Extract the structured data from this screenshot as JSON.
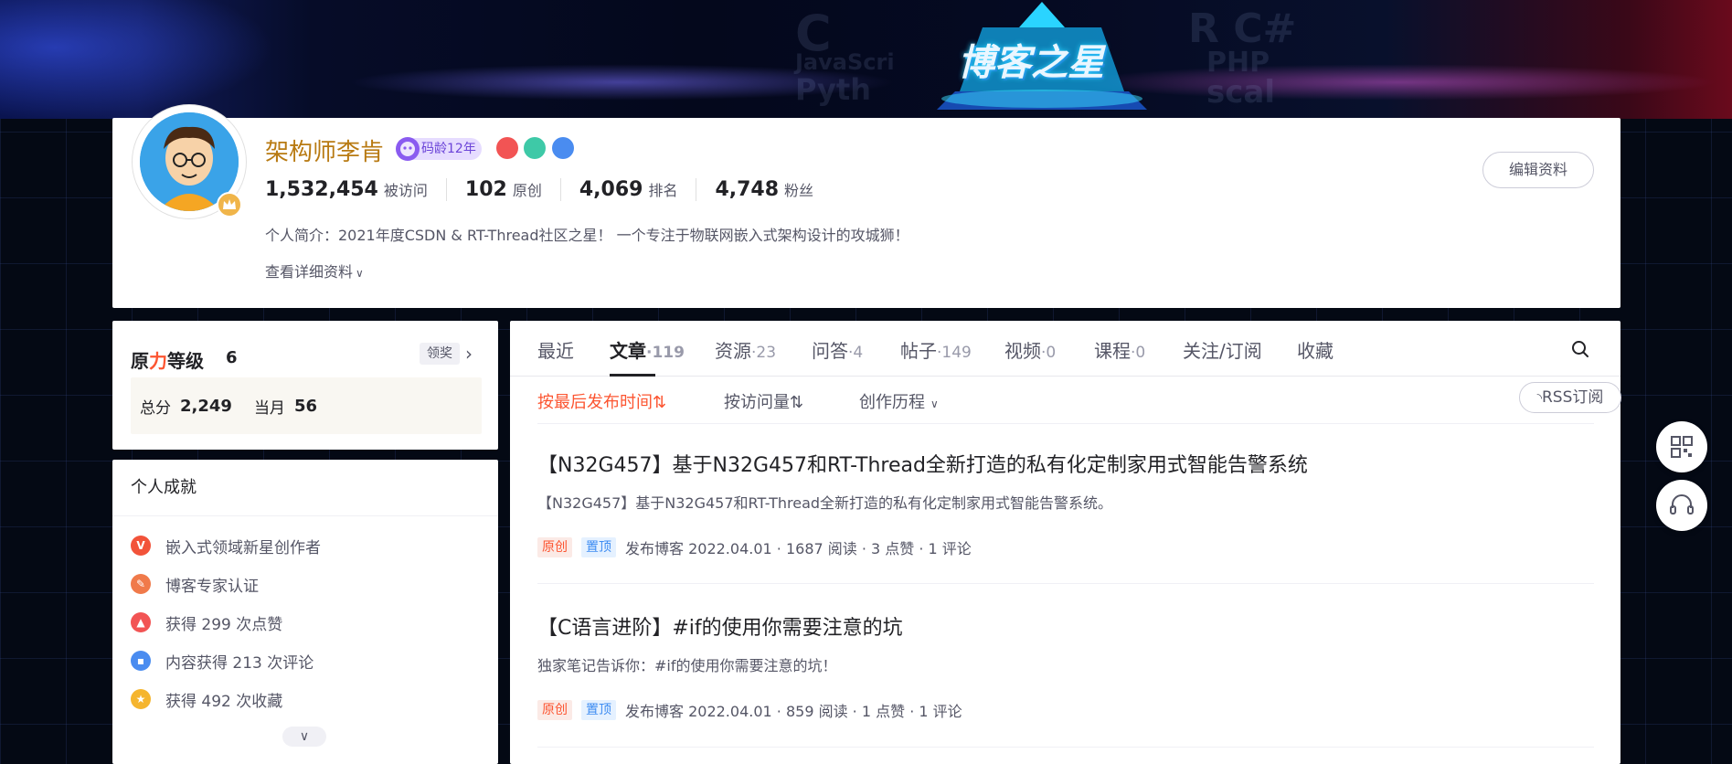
{
  "banner": {
    "title": "博客之星"
  },
  "profile": {
    "username": "架构师李肯",
    "code_age_badge": "码龄12年",
    "stats": [
      {
        "value": "1,532,454",
        "label": "被访问"
      },
      {
        "value": "102",
        "label": "原创"
      },
      {
        "value": "4,069",
        "label": "排名"
      },
      {
        "value": "4,748",
        "label": "粉丝"
      }
    ],
    "bio": "个人简介：2021年度CSDN & RT-Thread社区之星！ 一个专注于物联网嵌入式架构设计的攻城狮！",
    "more_label": "查看详细资料",
    "edit_label": "编辑资料"
  },
  "rank": {
    "title_a": "原",
    "title_b": "力",
    "title_c": "等级",
    "level": "6",
    "reward_label": "领奖",
    "total_label": "总分",
    "total_value": "2,249",
    "month_label": "当月",
    "month_value": "56"
  },
  "achievements": {
    "title": "个人成就",
    "items": [
      {
        "label": "嵌入式领域新星创作者",
        "color": "#f2533a",
        "icon": "v-badge-icon"
      },
      {
        "label": "博客专家认证",
        "color": "#f07a4a",
        "icon": "expert-badge-icon"
      },
      {
        "label": "获得 299 次点赞",
        "color": "#f25454",
        "icon": "like-badge-icon"
      },
      {
        "label": "内容获得 213 次评论",
        "color": "#4a8cf0",
        "icon": "comment-badge-icon"
      },
      {
        "label": "获得 492 次收藏",
        "color": "#f5b52e",
        "icon": "star-badge-icon"
      }
    ]
  },
  "tabs": [
    {
      "label": "最近",
      "count": ""
    },
    {
      "label": "文章",
      "count": "·119"
    },
    {
      "label": "资源",
      "count": "·23"
    },
    {
      "label": "问答",
      "count": "·4"
    },
    {
      "label": "帖子",
      "count": "·149"
    },
    {
      "label": "视频",
      "count": "·0"
    },
    {
      "label": "课程",
      "count": "·0"
    },
    {
      "label": "关注/订阅",
      "count": ""
    },
    {
      "label": "收藏",
      "count": ""
    }
  ],
  "sort": {
    "latest": "按最后发布时间⇅",
    "visits": "按访问量⇅",
    "history": "创作历程",
    "rss": "RSS订阅"
  },
  "articles": [
    {
      "title": "【N32G457】基于N32G457和RT-Thread全新打造的私有化定制家用式智能告警系统",
      "desc": "【N32G457】基于N32G457和RT-Thread全新打造的私有化定制家用式智能告警系统。",
      "tag_orig": "原创",
      "tag_top": "置顶",
      "meta": "发布博客 2022.04.01 ·  1687 阅读 ·  3 点赞 ·  1 评论"
    },
    {
      "title": "【C语言进阶】#if的使用你需要注意的坑",
      "desc": "独家笔记告诉你：#if的使用你需要注意的坑！",
      "tag_orig": "原创",
      "tag_top": "置顶",
      "meta": "发布博客 2022.04.01 ·  859 阅读 ·  1 点赞 ·  1 评论"
    }
  ],
  "colors": {
    "accent": "#fc5531",
    "username": "#b87a12",
    "link_blue": "#3d8cf2"
  }
}
